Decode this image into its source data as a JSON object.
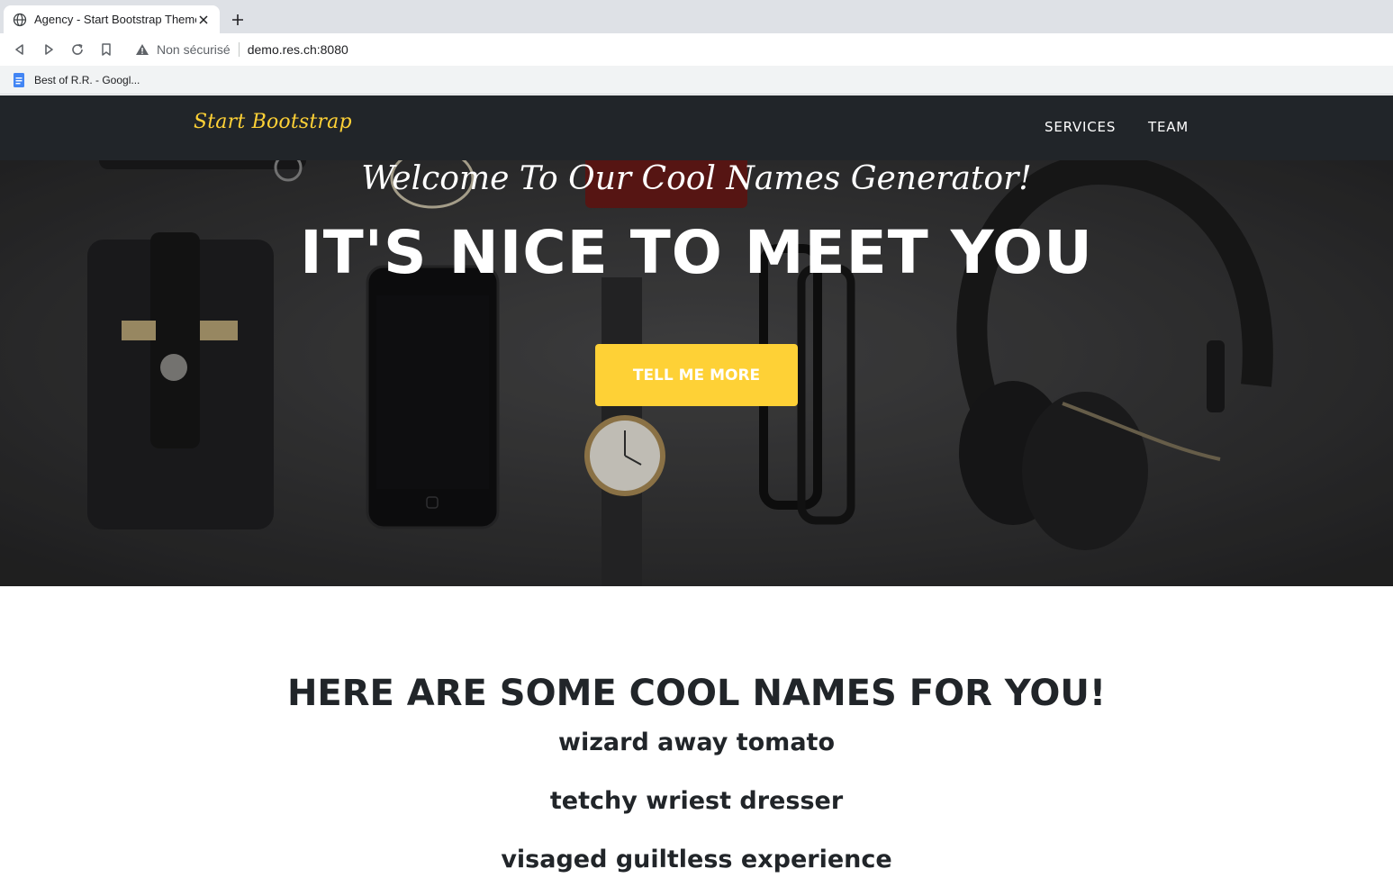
{
  "browser": {
    "tab_title": "Agency - Start Bootstrap Theme",
    "not_secure_label": "Non sécurisé",
    "url": "demo.res.ch:8080",
    "bookmark_label": "Best of R.R. - Googl..."
  },
  "nav": {
    "brand": "Start Bootstrap",
    "links": [
      "SERVICES",
      "TEAM"
    ]
  },
  "hero": {
    "subheading": "Welcome To Our Cool Names Generator!",
    "heading": "IT'S NICE TO MEET YOU",
    "button_label": "TELL ME MORE"
  },
  "names": {
    "heading": "HERE ARE SOME COOL NAMES FOR YOU!",
    "items": [
      "wizard away tomato",
      "tetchy wriest dresser",
      "visaged guiltless experience"
    ]
  },
  "colors": {
    "accent": "#fed136",
    "navbar": "#212529",
    "text_dark": "#212529"
  }
}
